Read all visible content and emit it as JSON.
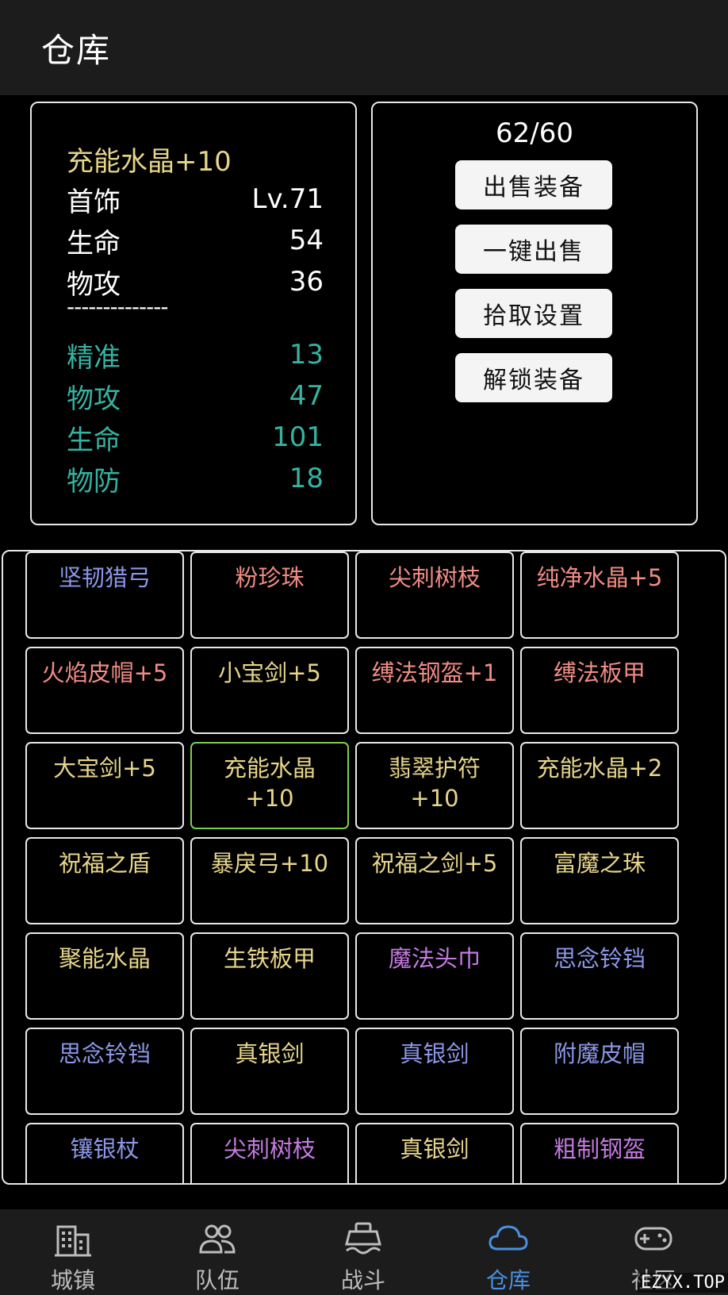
{
  "header": {
    "title": "仓库"
  },
  "detail": {
    "item_name": "充能水晶+10",
    "base_stats": [
      {
        "label": "首饰",
        "value": "Lv.71"
      },
      {
        "label": "生命",
        "value": "54"
      },
      {
        "label": "物攻",
        "value": "36"
      }
    ],
    "divider": "--------------",
    "bonus_stats": [
      {
        "label": "精准",
        "value": "13"
      },
      {
        "label": "物攻",
        "value": "47"
      },
      {
        "label": "生命",
        "value": "101"
      },
      {
        "label": "物防",
        "value": "18"
      }
    ],
    "colors": {
      "name": "#e6d58a",
      "bonus": "#35b3a2"
    }
  },
  "actions": {
    "capacity": "62/60",
    "buttons": [
      "出售装备",
      "一键出售",
      "拾取设置",
      "解锁装备"
    ]
  },
  "inventory": {
    "rarity_colors": {
      "yellow": "#e6d58a",
      "red": "#ef8c84",
      "blue": "#8b96e6",
      "purple": "#c47ae0"
    },
    "items": [
      {
        "name": "坚韧猎弓",
        "color": "#8b96e6"
      },
      {
        "name": "粉珍珠",
        "color": "#ef8c84"
      },
      {
        "name": "尖刺树枝",
        "color": "#ef8c84"
      },
      {
        "name": "纯净水晶+5",
        "color": "#ef8c84"
      },
      {
        "name": "火焰皮帽+5",
        "color": "#ef8c84"
      },
      {
        "name": "小宝剑+5",
        "color": "#e6d58a"
      },
      {
        "name": "缚法钢盔+1",
        "color": "#ef8c84"
      },
      {
        "name": "缚法板甲",
        "color": "#ef8c84"
      },
      {
        "name": "大宝剑+5",
        "color": "#e6d58a"
      },
      {
        "name": "充能水晶\n+10",
        "color": "#e6d58a",
        "selected": true
      },
      {
        "name": "翡翠护符\n+10",
        "color": "#e6d58a"
      },
      {
        "name": "充能水晶+2",
        "color": "#e6d58a"
      },
      {
        "name": "祝福之盾",
        "color": "#e6d58a"
      },
      {
        "name": "暴戾弓+10",
        "color": "#e6d58a"
      },
      {
        "name": "祝福之剑+5",
        "color": "#e6d58a"
      },
      {
        "name": "富魔之珠",
        "color": "#e6d58a"
      },
      {
        "name": "聚能水晶",
        "color": "#e6d58a"
      },
      {
        "name": "生铁板甲",
        "color": "#e6d58a"
      },
      {
        "name": "魔法头巾",
        "color": "#c47ae0"
      },
      {
        "name": "思念铃铛",
        "color": "#8b96e6"
      },
      {
        "name": "思念铃铛",
        "color": "#8b96e6"
      },
      {
        "name": "真银剑",
        "color": "#e6d58a"
      },
      {
        "name": "真银剑",
        "color": "#8b96e6"
      },
      {
        "name": "附魔皮帽",
        "color": "#8b96e6"
      },
      {
        "name": "镶银杖",
        "color": "#8b96e6"
      },
      {
        "name": "尖刺树枝",
        "color": "#c47ae0"
      },
      {
        "name": "真银剑",
        "color": "#e6d58a"
      },
      {
        "name": "粗制钢盔",
        "color": "#c47ae0"
      }
    ]
  },
  "nav": {
    "active_color": "#4a90e2",
    "items": [
      {
        "label": "城镇",
        "icon": "building-icon"
      },
      {
        "label": "队伍",
        "icon": "people-icon"
      },
      {
        "label": "战斗",
        "icon": "ship-icon"
      },
      {
        "label": "仓库",
        "icon": "cloud-icon",
        "active": true
      },
      {
        "label": "社区",
        "icon": "gamepad-icon"
      }
    ]
  },
  "watermark": "EZYX.TOP"
}
